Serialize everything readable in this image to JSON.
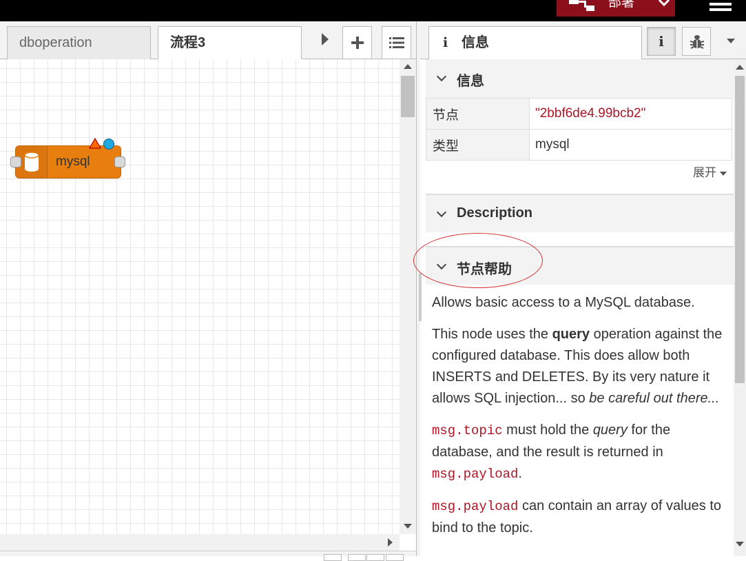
{
  "header": {
    "deploy_label": "部署",
    "menu_icon": "hamburger-icon"
  },
  "workspace": {
    "tabs": [
      {
        "label": "dboperation",
        "active": false
      },
      {
        "label": "流程3",
        "active": true
      }
    ],
    "buttons": [
      "scroll-right-icon",
      "add-icon",
      "list-icon"
    ]
  },
  "canvas": {
    "node": {
      "label": "mysql",
      "icon": "database-icon",
      "color": "#e87e0e",
      "status": [
        "warning-triangle-icon",
        "changed-dot-icon"
      ]
    }
  },
  "sidebar": {
    "tab_label": "信息",
    "tab_icon": "info-icon",
    "buttons": [
      "info-icon",
      "debug-bug-icon"
    ],
    "info_section": {
      "title": "信息",
      "rows": [
        {
          "key": "节点",
          "value": "\"2bbf6de4.99bcb2\""
        },
        {
          "key": "类型",
          "value": "mysql"
        }
      ],
      "expand_label": "展开"
    },
    "description_section": {
      "title": "Description"
    },
    "help_section": {
      "title": "节点帮助",
      "p1": "Allows basic access to a MySQL database.",
      "p2_a": "This node uses the ",
      "p2_b": "query",
      "p2_c": " operation against the configured database. This does allow both INSERTS and DELETES. By its very nature it allows SQL injection... so ",
      "p2_d": "be careful out there...",
      "p3_code1": "msg.topic",
      "p3_a": " must hold the ",
      "p3_em": "query",
      "p3_b": " for the database, and the result is returned in ",
      "p3_code2": "msg.payload",
      "p3_c": ".",
      "p4_code": "msg.payload",
      "p4_a": " can contain an array of values to bind to the topic."
    }
  },
  "colors": {
    "deploy": "#8c101c",
    "accent_red": "#ad1625",
    "annotation": "#d32f2f"
  }
}
